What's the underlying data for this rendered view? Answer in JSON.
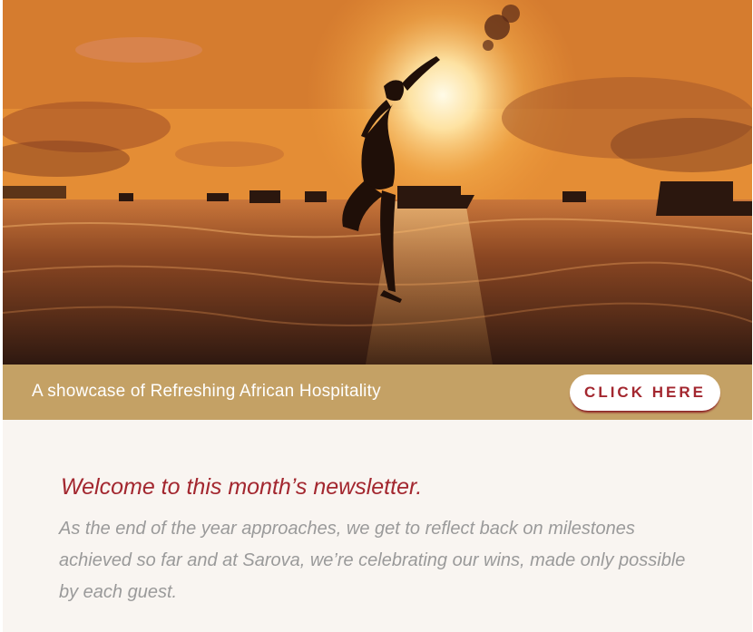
{
  "hero": {
    "image_icon": "sunset-beach-dancer-photo"
  },
  "banner": {
    "tagline": "A showcase of Refreshing African Hospitality",
    "cta_label": "CLICK HERE"
  },
  "newsletter": {
    "heading": "Welcome to this month’s newsletter.",
    "body": "As the end of the year approaches, we get to reflect back on milestones achieved so far and at Sarova, we’re celebrating our wins, made only possible by each guest."
  },
  "colors": {
    "banner_bg": "#c4a165",
    "accent_red": "#a3272f",
    "content_bg": "#f9f5f1",
    "body_text": "#9a9a9a"
  }
}
